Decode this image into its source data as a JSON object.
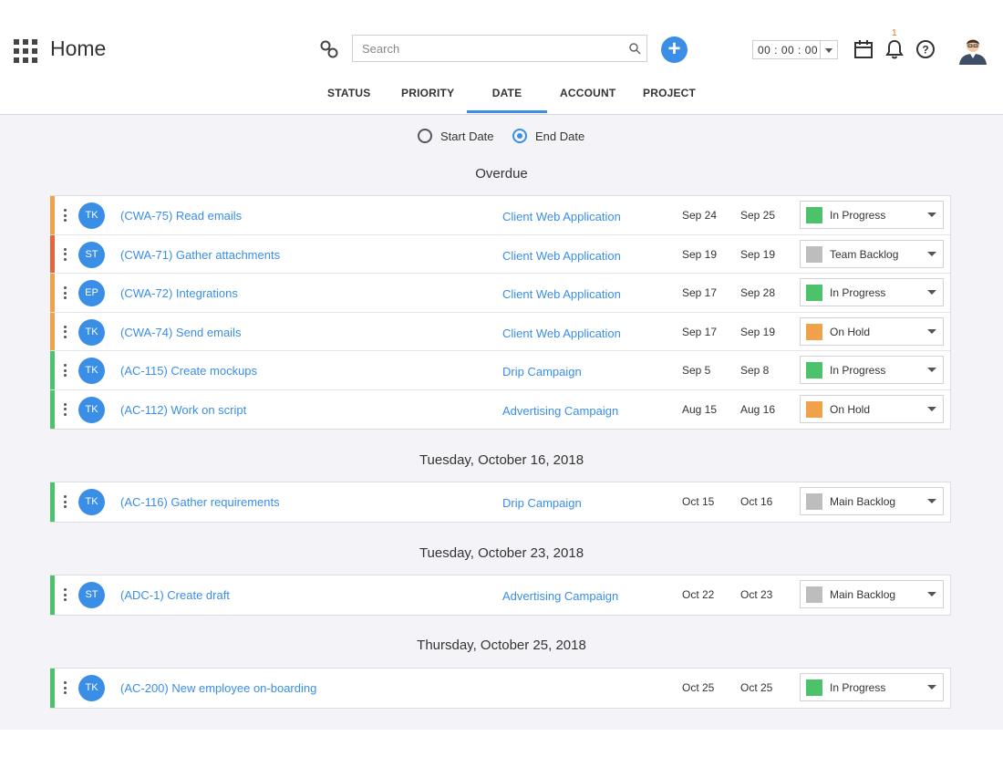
{
  "header": {
    "title": "Home",
    "search_placeholder": "Search",
    "timer": "00 : 00 : 00",
    "notification_count": "1"
  },
  "tabs": [
    {
      "label": "STATUS",
      "active": false
    },
    {
      "label": "PRIORITY",
      "active": false
    },
    {
      "label": "DATE",
      "active": true
    },
    {
      "label": "ACCOUNT",
      "active": false
    },
    {
      "label": "PROJECT",
      "active": false
    }
  ],
  "date_filter": {
    "start_label": "Start Date",
    "end_label": "End Date",
    "selected": "End Date"
  },
  "colors": {
    "accent": "#3a8ee6",
    "in_progress": "#4cc36b",
    "backlog": "#bdbdbd",
    "on_hold": "#f0a24a",
    "priority_orange": "#f0a24a",
    "priority_red": "#e8643a",
    "priority_green": "#4cc36b"
  },
  "groups": [
    {
      "title": "Overdue",
      "rows": [
        {
          "priority": "#f0a24a",
          "initials": "TK",
          "task": "(CWA-75) Read emails",
          "project": "Client Web Application",
          "start": "Sep 24",
          "end": "Sep 25",
          "status": "In Progress",
          "status_color": "#4cc36b"
        },
        {
          "priority": "#e8643a",
          "initials": "ST",
          "task": "(CWA-71) Gather attachments",
          "project": "Client Web Application",
          "start": "Sep 19",
          "end": "Sep 19",
          "status": "Team Backlog",
          "status_color": "#bdbdbd"
        },
        {
          "priority": "#f0a24a",
          "initials": "EP",
          "task": "(CWA-72) Integrations",
          "project": "Client Web Application",
          "start": "Sep 17",
          "end": "Sep 28",
          "status": "In Progress",
          "status_color": "#4cc36b"
        },
        {
          "priority": "#f0a24a",
          "initials": "TK",
          "task": "(CWA-74) Send emails",
          "project": "Client Web Application",
          "start": "Sep 17",
          "end": "Sep 19",
          "status": "On Hold",
          "status_color": "#f0a24a"
        },
        {
          "priority": "#4cc36b",
          "initials": "TK",
          "task": "(AC-115) Create mockups",
          "project": "Drip Campaign",
          "start": "Sep 5",
          "end": "Sep 8",
          "status": "In Progress",
          "status_color": "#4cc36b"
        },
        {
          "priority": "#4cc36b",
          "initials": "TK",
          "task": "(AC-112) Work on script",
          "project": "Advertising Campaign",
          "start": "Aug 15",
          "end": "Aug 16",
          "status": "On Hold",
          "status_color": "#f0a24a"
        }
      ]
    },
    {
      "title": "Tuesday, October 16, 2018",
      "rows": [
        {
          "priority": "#4cc36b",
          "initials": "TK",
          "task": "(AC-116) Gather requirements",
          "project": "Drip Campaign",
          "start": "Oct 15",
          "end": "Oct 16",
          "status": "Main Backlog",
          "status_color": "#bdbdbd"
        }
      ]
    },
    {
      "title": "Tuesday, October 23, 2018",
      "rows": [
        {
          "priority": "#4cc36b",
          "initials": "ST",
          "task": "(ADC-1) Create draft",
          "project": "Advertising Campaign",
          "start": "Oct 22",
          "end": "Oct 23",
          "status": "Main Backlog",
          "status_color": "#bdbdbd"
        }
      ]
    },
    {
      "title": "Thursday, October 25, 2018",
      "rows": [
        {
          "priority": "#4cc36b",
          "initials": "TK",
          "task": "(AC-200) New employee on-boarding",
          "project": "",
          "start": "Oct 25",
          "end": "Oct 25",
          "status": "In Progress",
          "status_color": "#4cc36b"
        }
      ]
    }
  ]
}
